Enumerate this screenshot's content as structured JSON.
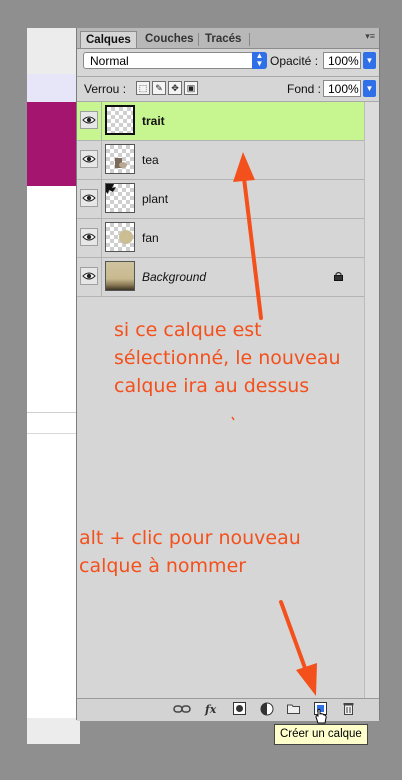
{
  "panel": {
    "tabs": [
      "Calques",
      "Couches",
      "Tracés"
    ],
    "blend_mode": "Normal",
    "opacity_label": "Opacité :",
    "opacity_value": "100%",
    "lock_label": "Verrou :",
    "fill_label": "Fond :",
    "fill_value": "100%"
  },
  "layers": [
    {
      "name": "trait",
      "selected": true,
      "visible": true
    },
    {
      "name": "tea",
      "selected": false,
      "visible": true
    },
    {
      "name": "plant",
      "selected": false,
      "visible": true
    },
    {
      "name": "fan",
      "selected": false,
      "visible": true
    },
    {
      "name": "Background",
      "selected": false,
      "visible": true,
      "locked": true
    }
  ],
  "footer": {
    "fx_label": "fx"
  },
  "tooltip": "Créer un calque",
  "annotations": {
    "top_lines": [
      "si ce calque est",
      "sélectionné, le nouveau",
      "calque ira au dessus"
    ],
    "bottom_lines": [
      "alt + clic pour nouveau",
      "calque à nommer"
    ]
  },
  "colors": {
    "accent": "#2f6fe8",
    "selected_layer": "#c7f58f",
    "annotation": "#f4501c",
    "document_band": "#a3156e"
  }
}
